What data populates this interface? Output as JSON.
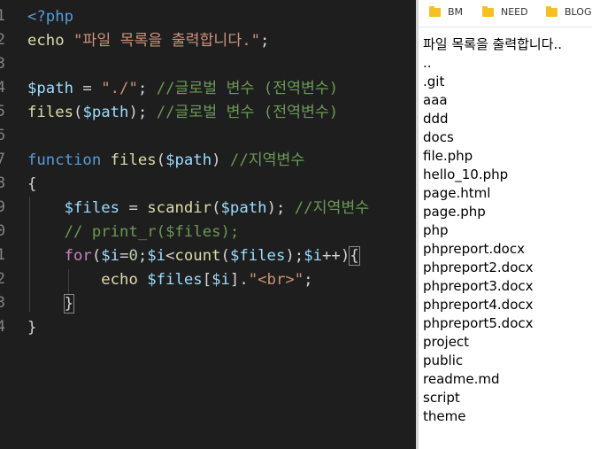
{
  "editor": {
    "line_numbers": [
      "1",
      "2",
      "3",
      "4",
      "5",
      "6",
      "7",
      "8",
      "9",
      "0",
      "1",
      "2",
      "3",
      "4"
    ],
    "tokens": {
      "php_open": "<?php",
      "echo1": "echo",
      "str1": "\"파일 목록을 출력합니다.\"",
      "semi": ";",
      "path_var": "$path",
      "assign": " = ",
      "path_str": "\"./\"",
      "cm_global": "//글로벌 변수 (전역변수)",
      "files_fn": "files",
      "lparen": "(",
      "rparen": ")",
      "semi_sp": "; ",
      "kw_function": "function",
      "cm_local": "//지역변수",
      "brace_open": "{",
      "files_var": "$files",
      "scandir_fn": "scandir",
      "cm_print": "// print_r($files);",
      "kw_for": "for",
      "i_var": "$i",
      "eq": "=",
      "zero": "0",
      "lt": "<",
      "count_fn": "count",
      "inc": "++",
      "echo2": "echo",
      "idx_open": "[",
      "idx_close": "]",
      "dot": ".",
      "br_str": "\"<br>\"",
      "brace_close": "}"
    }
  },
  "bookmarks": [
    {
      "icon": "folder-icon",
      "label": "BM"
    },
    {
      "icon": "folder-icon",
      "label": "NEED"
    },
    {
      "icon": "folder-icon",
      "label": "BLOG"
    }
  ],
  "output_lines": [
    "파일 목록을 출력합니다..",
    "..",
    ".git",
    "aaa",
    "ddd",
    "docs",
    "file.php",
    "hello_10.php",
    "page.html",
    "page.php",
    "php",
    "phpreport.docx",
    "phpreport2.docx",
    "phpreport3.docx",
    "phpreport4.docx",
    "phpreport5.docx",
    "project",
    "public",
    "readme.md",
    "script",
    "theme"
  ]
}
